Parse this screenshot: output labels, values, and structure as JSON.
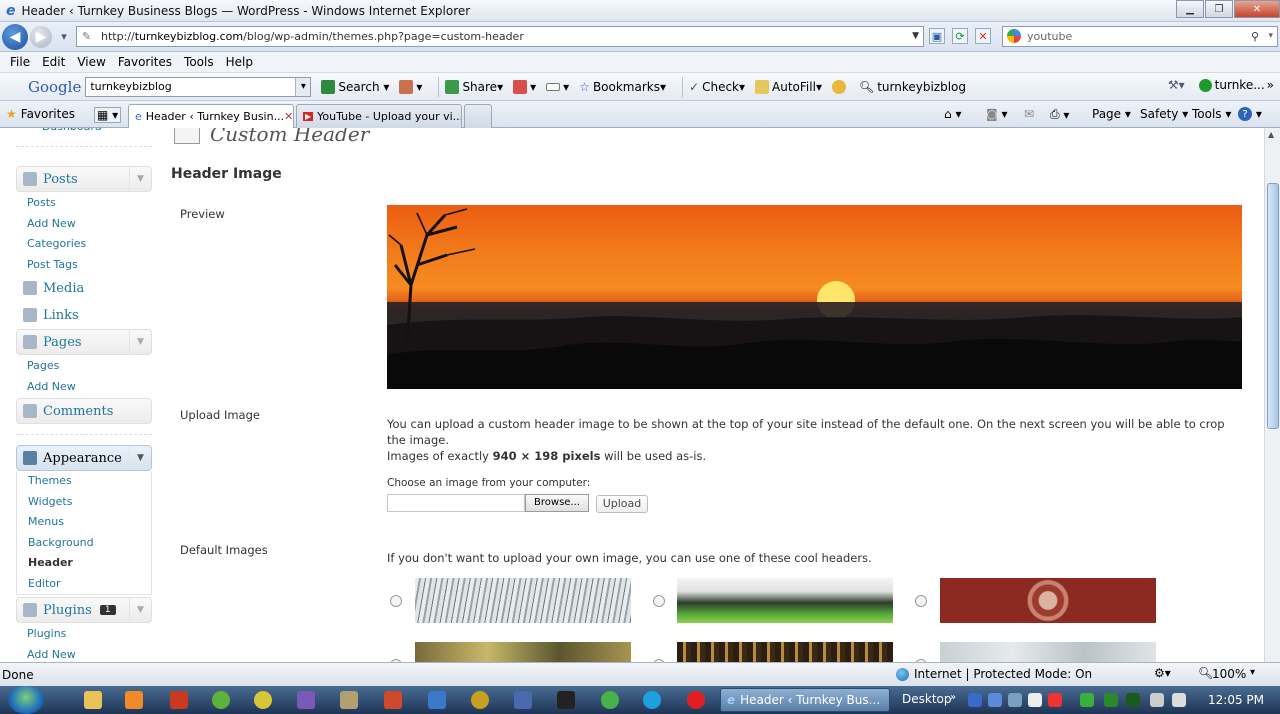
{
  "window": {
    "title": "Header ‹ Turnkey Business Blogs — WordPress - Windows Internet Explorer"
  },
  "addressbar": {
    "url_prefix": "http://",
    "url_domain": "turnkeybizblog.com",
    "url_path": "/blog/wp-admin/themes.php?page=custom-header",
    "search_value": "youtube"
  },
  "menubar": {
    "items": [
      "File",
      "Edit",
      "View",
      "Favorites",
      "Tools",
      "Help"
    ]
  },
  "googlebar": {
    "logo": "Google",
    "search_value": "turnkeybizblog",
    "search_label": "Search",
    "share_label": "Share",
    "bookmarks_label": "Bookmarks",
    "check_label": "Check",
    "autofill_label": "AutoFill",
    "site_label": "turnkeybizblog",
    "account_label": "turnke..."
  },
  "favbar": {
    "favorites_label": "Favorites",
    "tabs": [
      {
        "label": "Header ‹ Turnkey Busin..."
      },
      {
        "label": "YouTube - Upload your vi..."
      }
    ],
    "page_label": "Page",
    "safety_label": "Safety",
    "tools_label": "Tools"
  },
  "sidebar": {
    "dashboard_label": "Dashboard",
    "posts": {
      "label": "Posts",
      "items": [
        "Posts",
        "Add New",
        "Categories",
        "Post Tags"
      ]
    },
    "media_label": "Media",
    "links_label": "Links",
    "pages": {
      "label": "Pages",
      "items": [
        "Pages",
        "Add New"
      ]
    },
    "comments_label": "Comments",
    "appearance": {
      "label": "Appearance",
      "items": [
        "Themes",
        "Widgets",
        "Menus",
        "Background",
        "Header",
        "Editor"
      ],
      "current": "Header"
    },
    "plugins": {
      "label": "Plugins",
      "badge": "1",
      "items": [
        "Plugins",
        "Add New"
      ]
    }
  },
  "main": {
    "page_title": "Custom Header",
    "section_title": "Header Image",
    "preview_label": "Preview",
    "upload_label": "Upload Image",
    "upload_desc": "You can upload a custom header image to be shown at the top of your site instead of the default one. On the next screen you will be able to crop the image.",
    "size_prefix": "Images of exactly ",
    "size_value": "940 × 198 pixels",
    "size_suffix": " will be used as-is.",
    "choose_label": "Choose an image from your computer:",
    "browse_label": "Browse...",
    "upload_button": "Upload",
    "default_label": "Default Images",
    "default_desc": "If you don't want to upload your own image, you can use one of these cool headers."
  },
  "statusbar": {
    "status": "Done",
    "zone": "Internet | Protected Mode: On",
    "zoom": "100%"
  },
  "taskbar": {
    "task_label": "Header ‹ Turnkey Bus...",
    "desktop_label": "Desktop",
    "clock": "12:05 PM"
  },
  "colors": {
    "wp_link": "#21759b",
    "ie_blue": "#1c4f9a",
    "sunset_orange": "#f07a1a"
  }
}
